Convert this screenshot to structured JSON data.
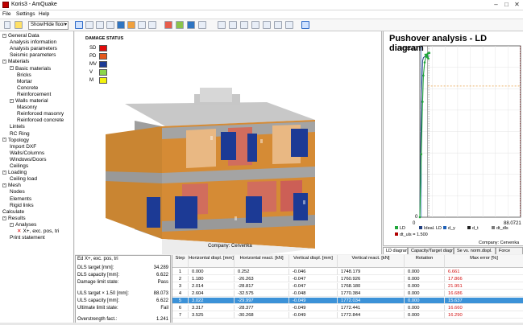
{
  "app": {
    "title": "Koris3 - AmQuake",
    "window_controls": {
      "minimize": "–",
      "maximize": "□",
      "close": "✕"
    }
  },
  "menu": [
    "File",
    "Settings",
    "Help"
  ],
  "toolbar": {
    "floor_select": "Show/Hide floor",
    "icons": [
      "undo-icon",
      "info-icon",
      "view-3d-icon",
      "frame-icon",
      "fit-icon",
      "grid-icon",
      "cube-icon",
      "walls-icon",
      "color-icon",
      "hide-icon",
      "section-icon",
      "selection-icon",
      "rotate-icon",
      "pan-icon",
      "zoom-in-icon",
      "zoom-out-icon",
      "zoom-extent-icon",
      "axis-icon"
    ]
  },
  "tree": [
    {
      "label": "General Data",
      "level": 0,
      "expand": "-"
    },
    {
      "label": "Analysis information",
      "level": 1
    },
    {
      "label": "Analysis parameters",
      "level": 1
    },
    {
      "label": "Seismic parameters",
      "level": 1
    },
    {
      "label": "Materials",
      "level": 0,
      "expand": "-"
    },
    {
      "label": "Basic materials",
      "level": 1,
      "expand": "-"
    },
    {
      "label": "Bricks",
      "level": 2
    },
    {
      "label": "Mortar",
      "level": 2
    },
    {
      "label": "Concrete",
      "level": 2
    },
    {
      "label": "Reinforcement",
      "level": 2
    },
    {
      "label": "Walls material",
      "level": 1,
      "expand": "-"
    },
    {
      "label": "Masonry",
      "level": 2
    },
    {
      "label": "Reinforced masonry",
      "level": 2
    },
    {
      "label": "Reinforced concrete",
      "level": 2
    },
    {
      "label": "Lintels",
      "level": 1
    },
    {
      "label": "RC Ring",
      "level": 1
    },
    {
      "label": "Topology",
      "level": 0,
      "expand": "-"
    },
    {
      "label": "Import DXF",
      "level": 1
    },
    {
      "label": "Walls/Columns",
      "level": 1
    },
    {
      "label": "Windows/Doors",
      "level": 1
    },
    {
      "label": "Ceilings",
      "level": 1
    },
    {
      "label": "Loading",
      "level": 0,
      "expand": "-"
    },
    {
      "label": "Ceiling load",
      "level": 1
    },
    {
      "label": "Mesh",
      "level": 0,
      "expand": "-"
    },
    {
      "label": "Nodes",
      "level": 1
    },
    {
      "label": "Elements",
      "level": 1
    },
    {
      "label": "Rigid links",
      "level": 1
    },
    {
      "label": "Calculate",
      "level": 0
    },
    {
      "label": "Results",
      "level": 0,
      "expand": "-"
    },
    {
      "label": "Analyses",
      "level": 1,
      "expand": "-"
    },
    {
      "label": "X+, exc. pos, tri",
      "level": 2,
      "icon": "cross"
    },
    {
      "label": "Print statement",
      "level": 1
    }
  ],
  "damage_status": {
    "title": "DAMAGE STATUS",
    "items": [
      {
        "label": "SD",
        "color": "#e20b0b"
      },
      {
        "label": "PD",
        "color": "#e4571b"
      },
      {
        "label": "MV",
        "color": "#1c3a95"
      },
      {
        "label": "V",
        "color": "#8bd64b"
      },
      {
        "label": "M",
        "color": "#f2f20e"
      }
    ]
  },
  "viewport": {
    "company": "Company: Cervenka"
  },
  "graph": {
    "title": "Pushover analysis - LD diagram",
    "y_top": "32.6572",
    "x_right": "88.0721",
    "company": "Company: Cervenka",
    "legend": [
      {
        "label": "LD",
        "color": "#20a63b"
      },
      {
        "label": "Ideal. LD",
        "color": "#223f80"
      },
      {
        "label": "d_y",
        "color": "#1f61b7"
      },
      {
        "label": "d_t",
        "color": "#222222"
      },
      {
        "label": "dt_dls",
        "color": "#7a7a7a"
      },
      {
        "label": "dt_uls = 1.500",
        "color": "#b00000"
      }
    ]
  },
  "chart_data": {
    "type": "line",
    "title": "Pushover analysis - LD diagram",
    "xlim": [
      0,
      88.0721
    ],
    "ylim": [
      0,
      32.6572
    ],
    "x": [
      0,
      1.2,
      2.4,
      3.1,
      4.2,
      5.3,
      6.3,
      7.0,
      7.8,
      8.3
    ],
    "series": [
      {
        "name": "LD",
        "values": [
          0,
          12.0,
          22.0,
          27.0,
          29.5,
          30.6,
          31.0,
          31.2,
          31.3,
          31.3
        ]
      },
      {
        "name": "Ideal. LD",
        "values": [
          0,
          22.0,
          29.8,
          30.4,
          30.6,
          30.7,
          30.7,
          30.7,
          30.7,
          30.7
        ]
      }
    ],
    "vertical_markers": [
      {
        "name": "d_y",
        "value": 1.3
      },
      {
        "name": "d_t",
        "value": 6.8
      },
      {
        "name": "dt_dls",
        "value": 7.8
      }
    ],
    "horizontal_marker": {
      "name": "dt_uls = 1.500",
      "value": 25.0
    },
    "grid": true,
    "legend": "bottom"
  },
  "tabs": [
    "LD diagram",
    "Capacity/Target diagram",
    "Se vs. norm.displ.",
    "Force"
  ],
  "results_left": {
    "title": "Ed X+, exc. pos, tri",
    "rows": [
      {
        "label": "DLS target [mm]:",
        "value": "34.289"
      },
      {
        "label": "DLS capacity [mm]:",
        "value": "6.622"
      },
      {
        "label": "Damage limit state:",
        "value": "Pass"
      },
      {
        "label": "ULS target × 1.50 [mm]:",
        "value": "88.073"
      },
      {
        "label": "ULS capacity [mm]:",
        "value": "6.622"
      },
      {
        "label": "Ultimate limit state:",
        "value": "Fail"
      },
      {
        "label": "Overstrength fact.:",
        "value": "1.241"
      }
    ]
  },
  "table": {
    "columns": [
      "Step",
      "Horizontal displ. [mm]",
      "Horizontal react. [kN]",
      "Vertical displ. [mm]",
      "Vertical react. [kN]",
      "Rotation",
      "Max error [%]"
    ],
    "rows": [
      [
        "1",
        "0.000",
        "0.252",
        "-0.046",
        "1748.179",
        "0.000",
        "6.661"
      ],
      [
        "2",
        "1.180",
        "-26.263",
        "-0.047",
        "1760.926",
        "0.000",
        "17.866"
      ],
      [
        "3",
        "2.014",
        "-28.817",
        "-0.047",
        "1768.180",
        "0.000",
        "21.951"
      ],
      [
        "4",
        "2.604",
        "-32.575",
        "-0.048",
        "1770.384",
        "0.000",
        "16.686"
      ],
      [
        "5",
        "3.022",
        "-29.997",
        "-0.049",
        "1772.034",
        "0.000",
        "15.637"
      ],
      [
        "6",
        "3.317",
        "-28.377",
        "-0.049",
        "1772.441",
        "0.000",
        "16.660"
      ],
      [
        "7",
        "3.525",
        "-30.268",
        "-0.049",
        "1772.844",
        "0.000",
        "16.290"
      ]
    ],
    "selected_row": 5
  }
}
